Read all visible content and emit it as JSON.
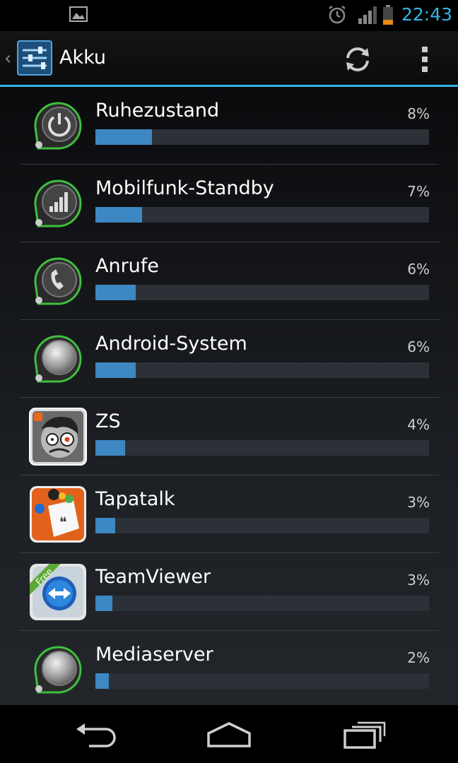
{
  "status_bar": {
    "time": "22:43",
    "icons": [
      "image-icon",
      "alarm-icon",
      "signal-icon",
      "battery-low-icon"
    ],
    "accent_color": "#33b5e5"
  },
  "action_bar": {
    "back_glyph": "‹",
    "title": "Akku",
    "icons": [
      "settings-sliders-icon",
      "refresh-icon",
      "overflow-menu-icon"
    ]
  },
  "battery_usage": {
    "bar_color": "#3d87c2",
    "items": [
      {
        "label": "Ruhezustand",
        "percent_text": "8%",
        "fill": 0.17,
        "icon": "power-icon"
      },
      {
        "label": "Mobilfunk-Standby",
        "percent_text": "7%",
        "fill": 0.14,
        "icon": "signal-bars-icon"
      },
      {
        "label": "Anrufe",
        "percent_text": "6%",
        "fill": 0.12,
        "icon": "phone-icon"
      },
      {
        "label": "Android-System",
        "percent_text": "6%",
        "fill": 0.12,
        "icon": "android-system-icon"
      },
      {
        "label": "ZS",
        "percent_text": "4%",
        "fill": 0.09,
        "icon": "zs-app-icon"
      },
      {
        "label": "Tapatalk",
        "percent_text": "3%",
        "fill": 0.06,
        "icon": "tapatalk-app-icon"
      },
      {
        "label": "TeamViewer",
        "percent_text": "3%",
        "fill": 0.05,
        "icon": "teamviewer-app-icon",
        "badge": "Free"
      },
      {
        "label": "Mediaserver",
        "percent_text": "2%",
        "fill": 0.04,
        "icon": "mediaserver-icon"
      }
    ]
  },
  "nav_bar": {
    "icons": [
      "back-icon",
      "home-icon",
      "recent-apps-icon"
    ]
  }
}
